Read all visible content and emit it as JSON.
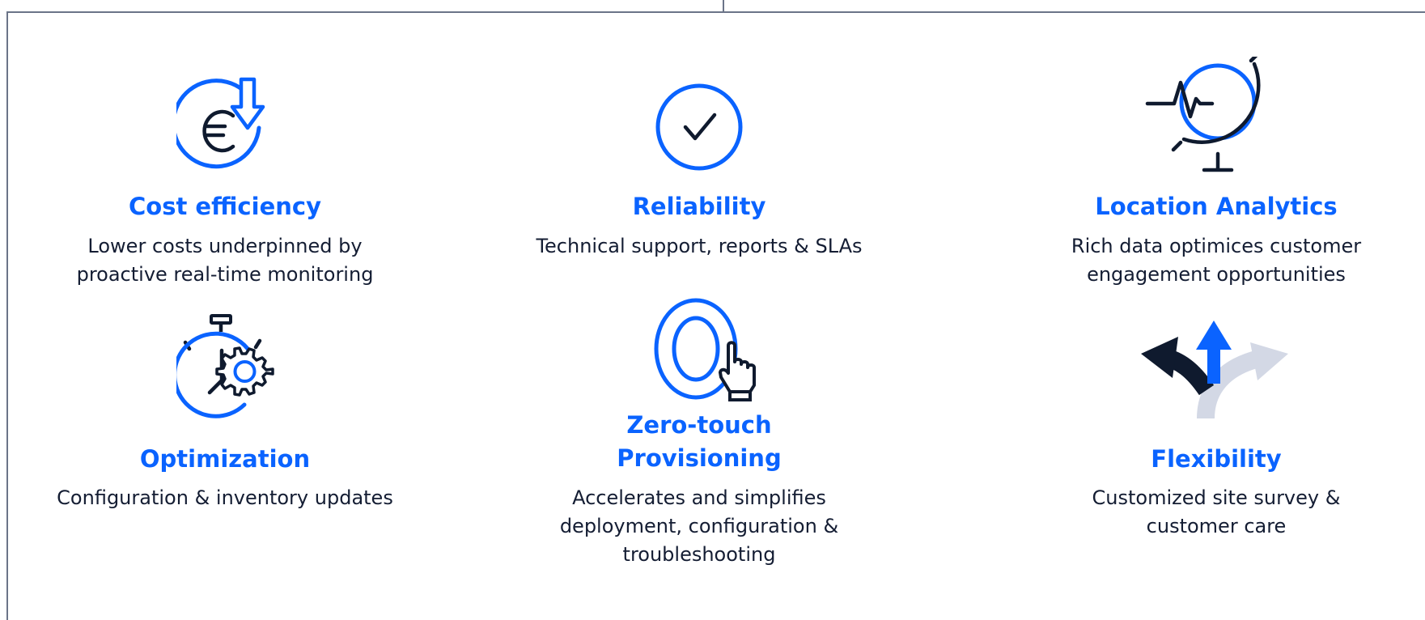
{
  "colors": {
    "accent": "#0a63ff",
    "dark": "#0f1a2e",
    "light": "#d3d8e5",
    "frame": "#6b7488"
  },
  "features": [
    {
      "icon": "euro-arrow-down-icon",
      "title": "Cost efficiency",
      "lines": [
        "Lower costs underpinned by",
        "proactive real-time monitoring"
      ]
    },
    {
      "icon": "checkmark-circle-icon",
      "title": "Reliability",
      "lines": [
        "Technical support, reports & SLAs"
      ]
    },
    {
      "icon": "globe-pulse-icon",
      "title": "Location Analytics",
      "lines": [
        "Rich data optimices customer",
        "engagement opportunities"
      ]
    },
    {
      "icon": "stopwatch-gear-icon",
      "title": "Optimization",
      "lines": [
        "Configuration & inventory updates"
      ]
    },
    {
      "icon": "zero-touch-hand-icon",
      "titleLines": [
        "Zero-touch",
        "Provisioning"
      ],
      "lines": [
        "Accelerates and simplifies",
        "deployment, configuration &",
        "troubleshooting"
      ]
    },
    {
      "icon": "split-arrows-icon",
      "title": "Flexibility",
      "lines": [
        "Customized site survey &",
        "customer care"
      ]
    }
  ]
}
